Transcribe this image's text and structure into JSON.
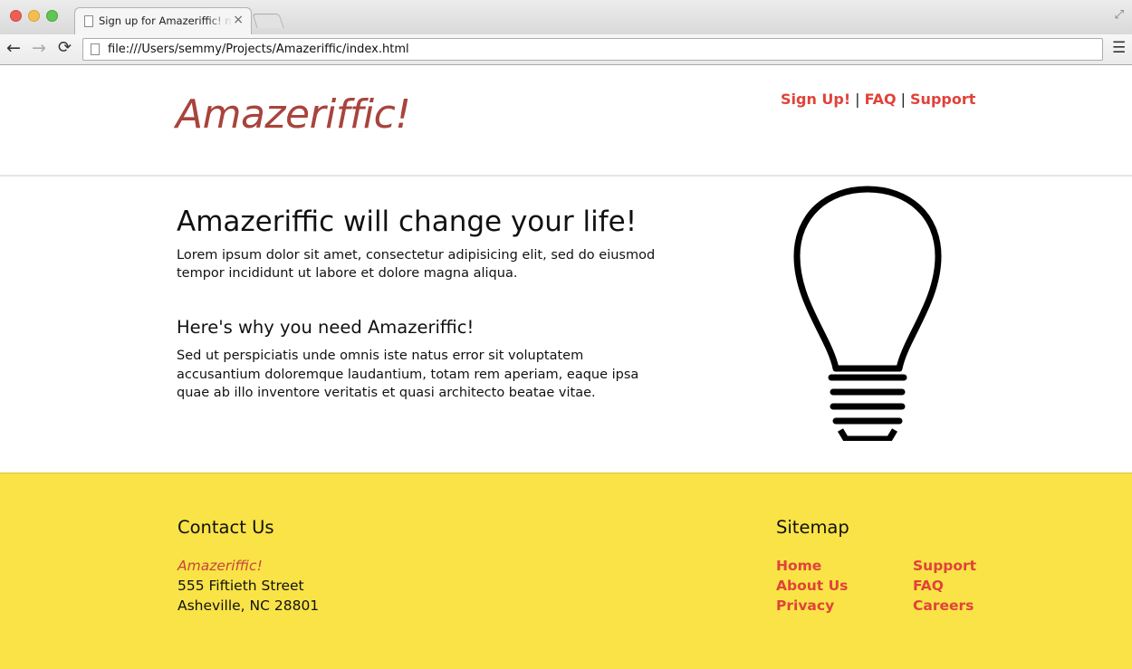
{
  "browser": {
    "tab_title": "Sign up for Amazeriffic! now",
    "tab_close": "×",
    "url": "file:///Users/semmy/Projects/Amazeriffic/index.html",
    "icons": {
      "back": "back-arrow-icon",
      "forward": "forward-arrow-icon",
      "reload": "reload-icon",
      "menu": "menu-icon",
      "fullscreen": "fullscreen-icon"
    }
  },
  "header": {
    "logo": "Amazeriffic!",
    "nav": {
      "signup": "Sign Up!",
      "faq": "FAQ",
      "support": "Support",
      "separator": "|"
    }
  },
  "main": {
    "title": "Amazeriffic will change your life!",
    "intro": "Lorem ipsum dolor sit amet, consectetur adipisicing elit, sed do eiusmod tempor incididunt ut labore et dolore magna aliqua.",
    "why_title": "Here's why you need Amazeriffic!",
    "why_text": "Sed ut perspiciatis unde omnis iste natus error sit voluptatem accusantium doloremque laudantium, totam rem aperiam, eaque ipsa quae ab illo inventore veritatis et quasi architecto beatae vitae.",
    "image": "lightbulb-icon"
  },
  "footer": {
    "contact_title": "Contact Us",
    "company": "Amazeriffic!",
    "street": "555 Fiftieth Street",
    "city": "Asheville, NC 28801",
    "sitemap_title": "Sitemap",
    "sitemap_col1": [
      "Home",
      "About Us",
      "Privacy"
    ],
    "sitemap_col2": [
      "Support",
      "FAQ",
      "Careers"
    ]
  },
  "colors": {
    "logo": "#a8443c",
    "link": "#e0433a",
    "footer_bg": "#f9e347"
  }
}
